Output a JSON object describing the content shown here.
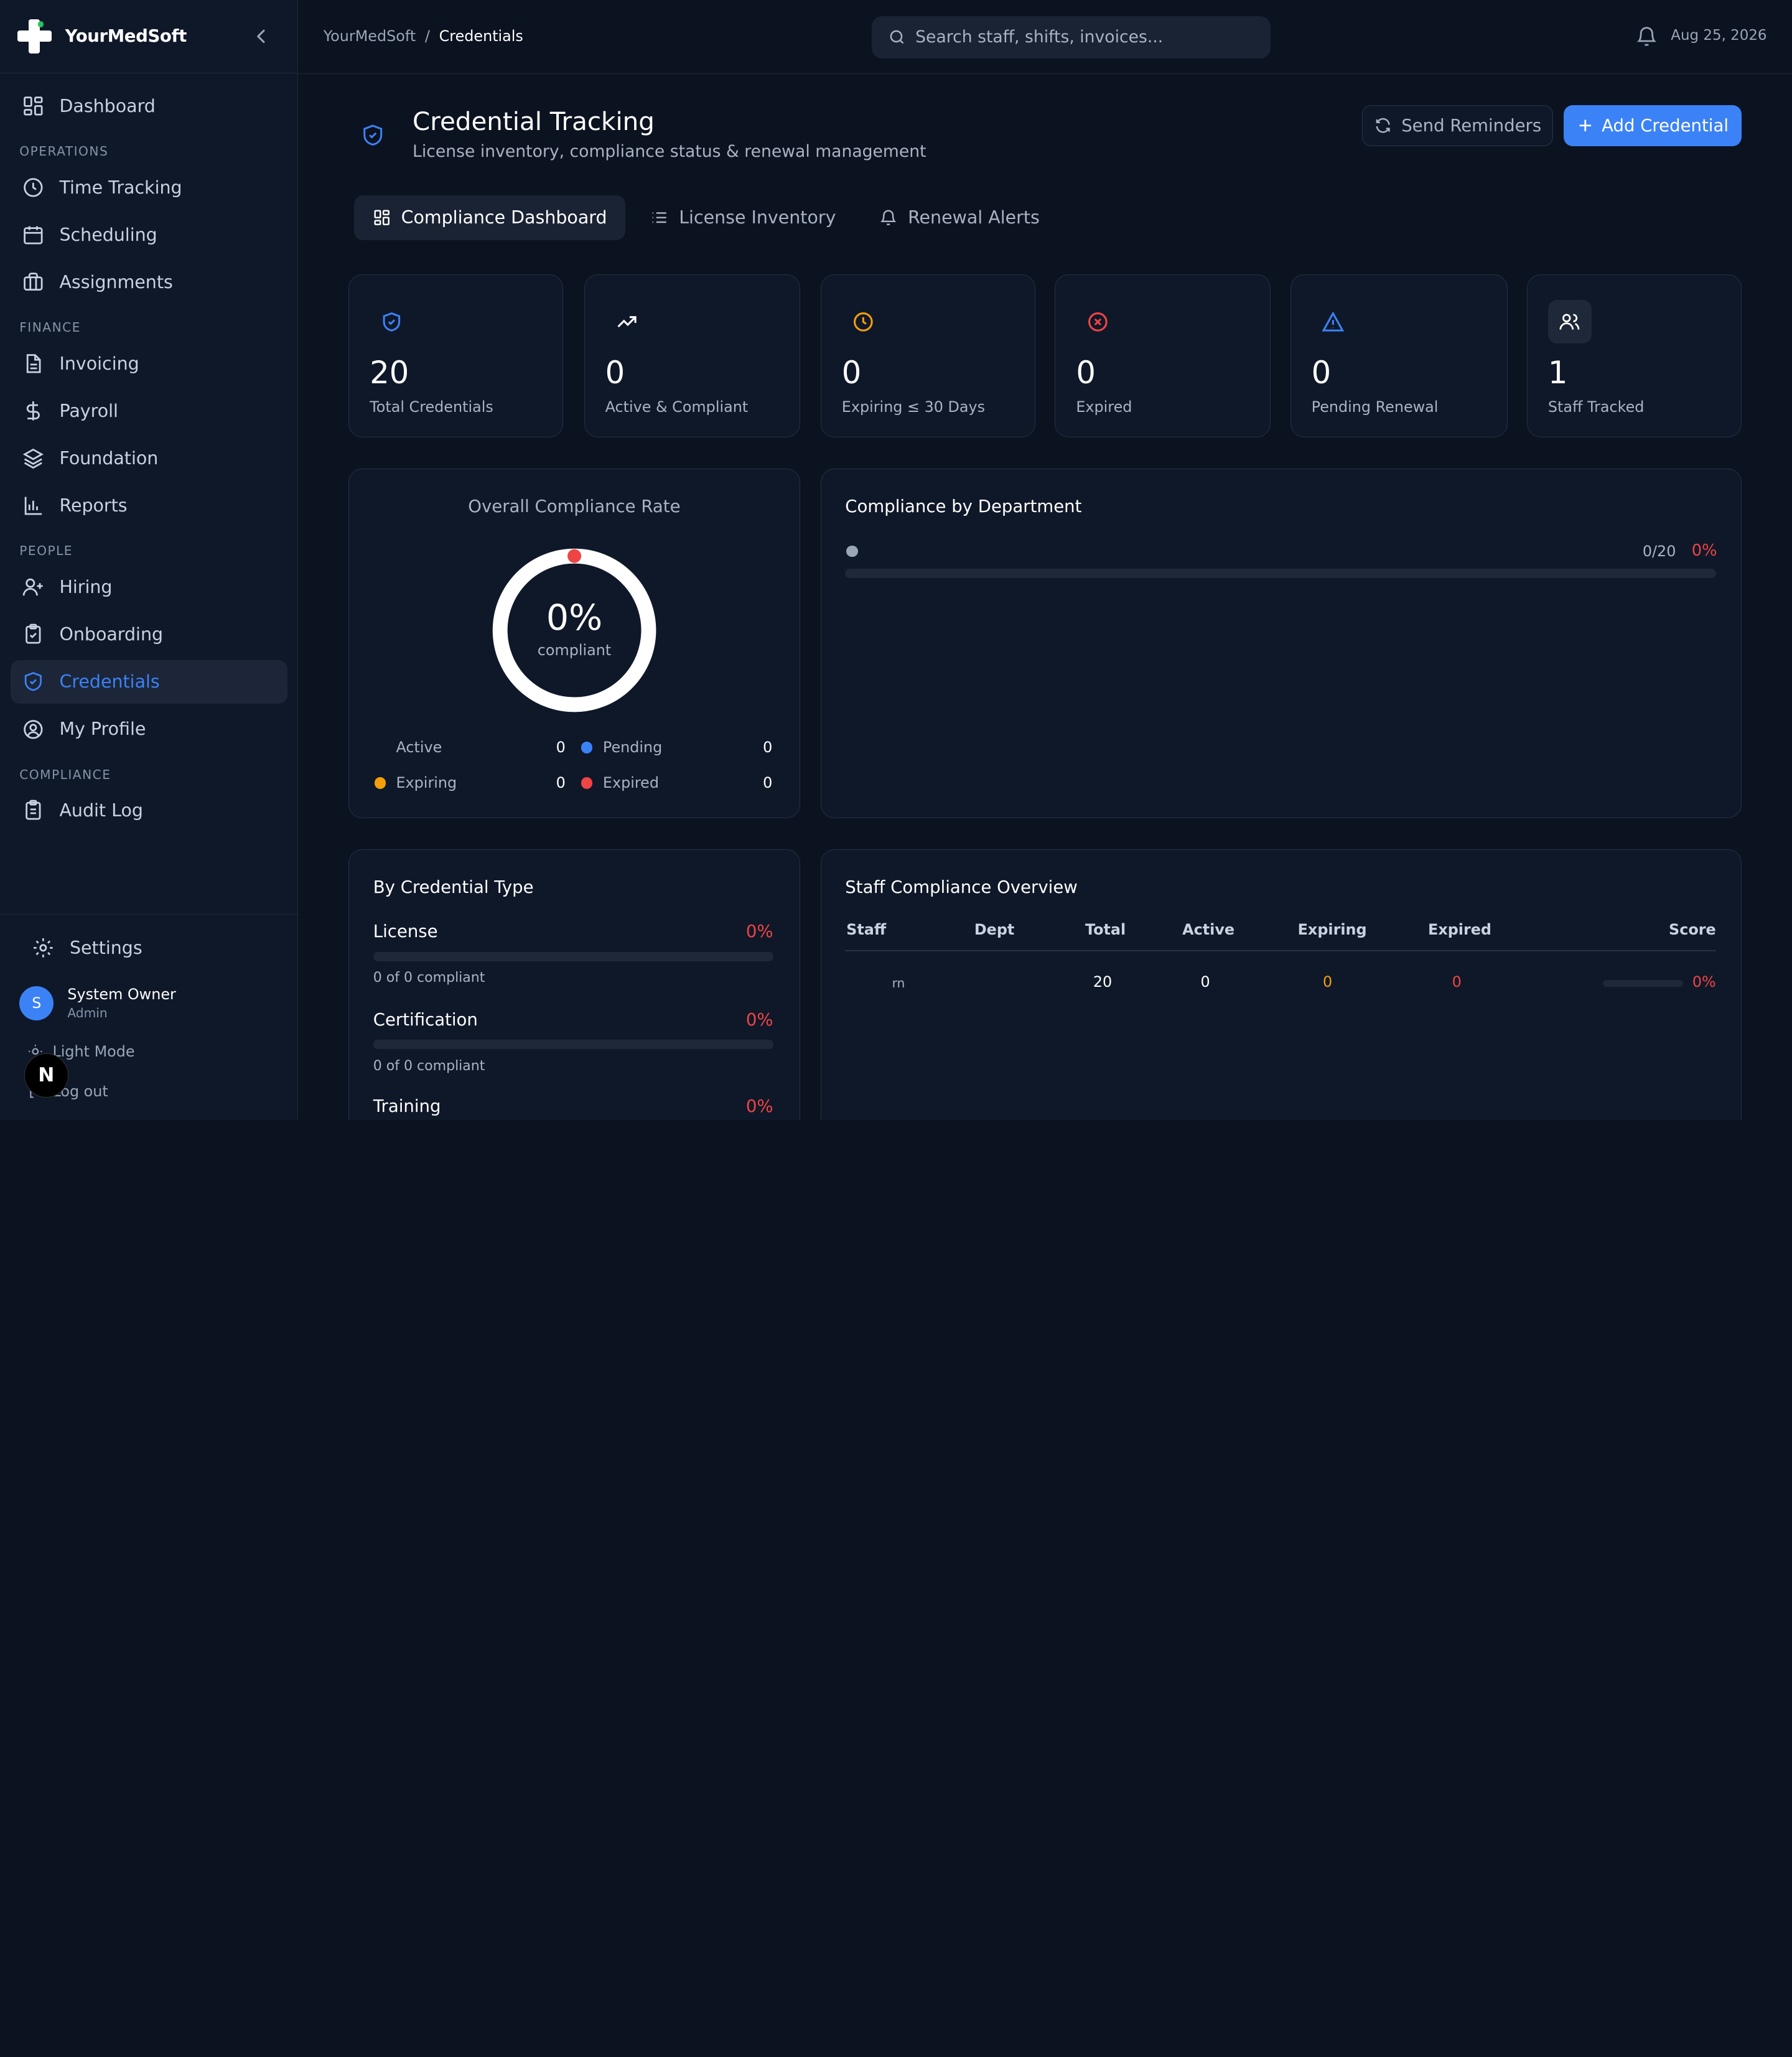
{
  "brand": {
    "name": "YourMedSoft"
  },
  "sidebar": {
    "items": [
      {
        "label": "Dashboard",
        "icon": "dashboard-icon"
      },
      {
        "group": "OPERATIONS"
      },
      {
        "label": "Time Tracking",
        "icon": "clock-icon"
      },
      {
        "label": "Scheduling",
        "icon": "calendar-icon"
      },
      {
        "label": "Assignments",
        "icon": "briefcase-icon"
      },
      {
        "group": "FINANCE"
      },
      {
        "label": "Invoicing",
        "icon": "document-icon"
      },
      {
        "label": "Payroll",
        "icon": "dollar-icon"
      },
      {
        "label": "Foundation",
        "icon": "layers-icon"
      },
      {
        "label": "Reports",
        "icon": "bar-chart-icon"
      },
      {
        "group": "PEOPLE"
      },
      {
        "label": "Hiring",
        "icon": "user-plus-icon"
      },
      {
        "label": "Onboarding",
        "icon": "clipboard-check-icon"
      },
      {
        "label": "Credentials",
        "icon": "shield-icon",
        "active": true
      },
      {
        "label": "My Profile",
        "icon": "user-circle-icon"
      },
      {
        "group": "COMPLIANCE"
      },
      {
        "label": "Audit Log",
        "icon": "clipboard-list-icon"
      }
    ],
    "settings_label": "Settings",
    "user": {
      "initial": "S",
      "name": "System Owner",
      "role": "Admin"
    },
    "light_mode_label": "Light Mode",
    "logout_label": "Log out",
    "badge_letter": "N"
  },
  "header": {
    "breadcrumb": {
      "root": "YourMedSoft",
      "sep": "/",
      "current": "Credentials"
    },
    "search_placeholder": "Search staff, shifts, invoices...",
    "date": "Aug 25, 2026"
  },
  "page": {
    "title": "Credential Tracking",
    "subtitle": "License inventory, compliance status & renewal management",
    "send_reminders_label": "Send Reminders",
    "add_credential_label": "Add Credential",
    "tabs": [
      {
        "label": "Compliance Dashboard",
        "active": true
      },
      {
        "label": "License Inventory"
      },
      {
        "label": "Renewal Alerts"
      }
    ]
  },
  "stats": [
    {
      "value": "20",
      "label": "Total Credentials",
      "color": "#3b82f6"
    },
    {
      "value": "0",
      "label": "Active & Compliant",
      "color": "#ffffff"
    },
    {
      "value": "0",
      "label": "Expiring ≤ 30 Days",
      "color": "#f59e0b"
    },
    {
      "value": "0",
      "label": "Expired",
      "color": "#ef4444"
    },
    {
      "value": "0",
      "label": "Pending Renewal",
      "color": "#3b82f6"
    },
    {
      "value": "1",
      "label": "Staff Tracked",
      "color": "#ffffff"
    }
  ],
  "compliance_rate": {
    "title": "Overall Compliance Rate",
    "percent": "0%",
    "percent_value": 0,
    "caption": "compliant",
    "legend": [
      {
        "label": "Active",
        "value": "0",
        "color": "#22c55e"
      },
      {
        "label": "Pending",
        "value": "0",
        "color": "#3b82f6"
      },
      {
        "label": "Expiring",
        "value": "0",
        "color": "#f59e0b"
      },
      {
        "label": "Expired",
        "value": "0",
        "color": "#ef4444"
      }
    ]
  },
  "department": {
    "title": "Compliance by Department",
    "rows": [
      {
        "count": "0/20",
        "percent": "0%"
      }
    ]
  },
  "by_type": {
    "title": "By Credential Type",
    "items": [
      {
        "name": "License",
        "percent": "0%",
        "sub": "0 of 0 compliant"
      },
      {
        "name": "Certification",
        "percent": "0%",
        "sub": "0 of 0 compliant"
      },
      {
        "name": "Training",
        "percent": "0%",
        "sub": ""
      }
    ]
  },
  "staff_overview": {
    "title": "Staff Compliance Overview",
    "columns": [
      "Staff",
      "Dept",
      "Total",
      "Active",
      "Expiring",
      "Expired",
      "Score"
    ],
    "rows": [
      {
        "staff": "rn",
        "dept": "",
        "total": "20",
        "active": "0",
        "expiring": "0",
        "expired": "0",
        "score": "0%"
      }
    ]
  }
}
